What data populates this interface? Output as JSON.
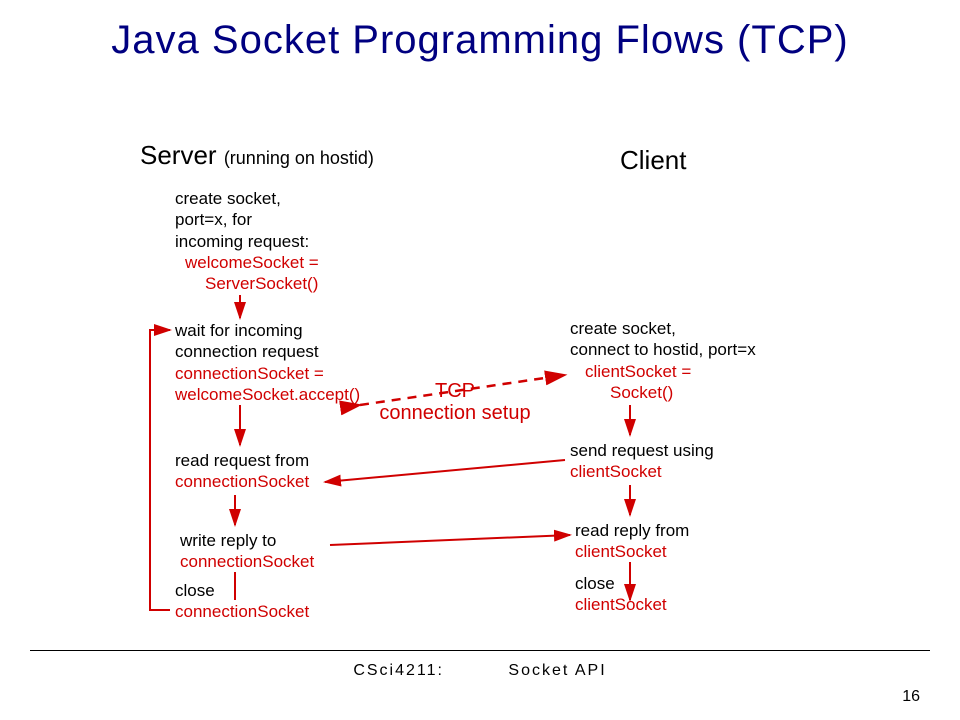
{
  "title": "Java Socket Programming Flows (TCP)",
  "server_heading": "Server",
  "server_sub": "(running on hostid)",
  "client_heading": "Client",
  "server": {
    "s1a": "create socket,",
    "s1b": "port=x, for",
    "s1c": "incoming request:",
    "s1code1": "welcomeSocket =",
    "s1code2": "ServerSocket()",
    "s2a": "wait for incoming",
    "s2b": "connection request",
    "s2code1": "connectionSocket =",
    "s2code2": "welcomeSocket.accept()",
    "s3a": "read request from",
    "s3code": "connectionSocket",
    "s4a": "write reply to",
    "s4code": "connectionSocket",
    "s5a": "close",
    "s5code": "connectionSocket"
  },
  "client": {
    "c1a": "create socket,",
    "c1b": "connect to hostid, port=x",
    "c1code1": "clientSocket =",
    "c1code2": "Socket()",
    "c2a": "send request using",
    "c2code": "clientSocket",
    "c3a": "read reply from",
    "c3code": "clientSocket",
    "c4a": "close",
    "c4code": "clientSocket"
  },
  "annot1": "TCP",
  "annot2": "connection setup",
  "footer_left": "CSci4211:",
  "footer_right": "Socket API",
  "page": "16",
  "colors": {
    "red": "#d00000",
    "navy": "#000080"
  }
}
